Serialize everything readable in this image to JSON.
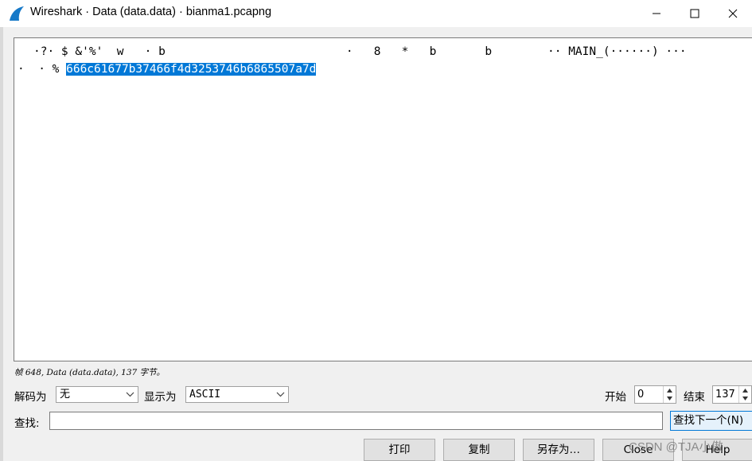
{
  "window": {
    "title": "Wireshark · Data (data.data) · bianma1.pcapng"
  },
  "content": {
    "line1": "·?· $ &'%'  w   · b                          ·   8   *   b       b        ·· MAIN_(······) ···",
    "line2_prefix": "·  · % ",
    "line2_selected": "666c61677b37466f4d3253746b6865507a7d"
  },
  "status": {
    "text": "帧 648, Data (data.data), 137 字节。"
  },
  "controls": {
    "decode_label": "解码为",
    "decode_value": "无",
    "show_as_label": "显示为",
    "show_as_value": "ASCII",
    "start_label": "开始",
    "start_value": "0",
    "end_label": "结束",
    "end_value": "137",
    "find_label": "查找:",
    "find_value": "",
    "find_next_label": "查找下一个(N)"
  },
  "buttons": {
    "print": "打印",
    "copy": "复制",
    "save_as": "另存为…",
    "close": "Close",
    "help": "Help"
  },
  "watermark": "CSDN @TJA小傲",
  "colors": {
    "selection": "#0078d7",
    "background": "#f0f0f0",
    "accent": "#0078d7"
  }
}
